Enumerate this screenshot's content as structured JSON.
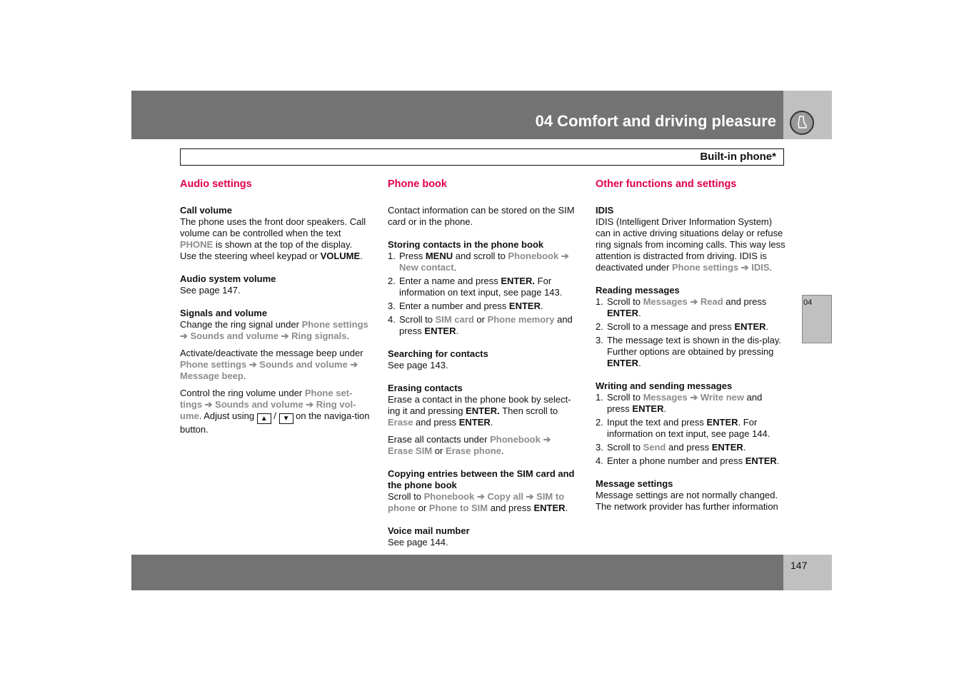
{
  "header": {
    "chapter": "04 Comfort and driving pleasure",
    "section": "Built-in phone*",
    "icon": "seat-icon",
    "tab": "04",
    "page": "147"
  },
  "colors": {
    "accent": "#e0004d",
    "menu": "#8c8c8c",
    "band": "#737373",
    "side": "#c0c0c0"
  },
  "columns": [
    [
      {
        "k": "h2",
        "t": "Audio settings"
      },
      {
        "k": "h3",
        "t": "Call volume"
      },
      {
        "k": "p",
        "s": [
          [
            "The phone uses the front door speakers. Call volume can be controlled when the text "
          ],
          [
            "PHONE",
            "m"
          ],
          [
            " is shown at the top of the display. Use the steering wheel keypad or "
          ],
          [
            "VOLUME",
            "b"
          ],
          [
            "."
          ]
        ]
      },
      {
        "k": "h3",
        "t": "Audio system volume"
      },
      {
        "k": "p",
        "s": [
          [
            "See page 147."
          ]
        ]
      },
      {
        "k": "h3",
        "t": "Signals and volume"
      },
      {
        "k": "p",
        "c": "tight",
        "s": [
          [
            "Change the ring signal under "
          ],
          [
            "Phone settings ➔ Sounds and volume ➔ Ring signals",
            "m"
          ],
          [
            "."
          ]
        ]
      },
      {
        "k": "p",
        "c": "tight",
        "s": [
          [
            "Activate/deactivate the message beep under "
          ],
          [
            "Phone settings ➔ Sounds and volume ➔ Message beep",
            "m"
          ],
          [
            "."
          ]
        ]
      },
      {
        "k": "p",
        "s": [
          [
            "Control the ring volume under "
          ],
          [
            "Phone set-tings ➔ Sounds and volume ➔ Ring vol-ume",
            "m"
          ],
          [
            ". Adjust using "
          ],
          [
            "▲",
            "key"
          ],
          [
            " / "
          ],
          [
            "▼",
            "key"
          ],
          [
            " on the naviga-tion button."
          ]
        ]
      }
    ],
    [
      {
        "k": "h2",
        "t": "Phone book"
      },
      {
        "k": "p",
        "s": [
          [
            "Contact information can be stored on the SIM card or in the phone."
          ]
        ]
      },
      {
        "k": "h3",
        "t": "Storing contacts in the phone book"
      },
      {
        "k": "ol",
        "items": [
          [
            [
              "Press "
            ],
            [
              "MENU",
              "b"
            ],
            [
              " and scroll to "
            ],
            [
              "Phonebook ➔ New contact",
              "m"
            ],
            [
              "."
            ]
          ],
          [
            [
              "Enter a name and press "
            ],
            [
              "ENTER.",
              "b"
            ],
            [
              " For information on text input, see page 143."
            ]
          ],
          [
            [
              "Enter a number and press "
            ],
            [
              "ENTER",
              "b"
            ],
            [
              "."
            ]
          ],
          [
            [
              "Scroll to "
            ],
            [
              "SIM card",
              "m"
            ],
            [
              " or "
            ],
            [
              "Phone memory",
              "m"
            ],
            [
              " and press "
            ],
            [
              "ENTER",
              "b"
            ],
            [
              "."
            ]
          ]
        ]
      },
      {
        "k": "h3",
        "t": "Searching for contacts"
      },
      {
        "k": "p",
        "s": [
          [
            "See page 143."
          ]
        ]
      },
      {
        "k": "h3",
        "t": "Erasing contacts"
      },
      {
        "k": "p",
        "c": "tight",
        "s": [
          [
            "Erase a contact in the phone book by select-ing it and pressing "
          ],
          [
            "ENTER.",
            "b"
          ],
          [
            " Then scroll to "
          ],
          [
            "Erase",
            "m"
          ],
          [
            " and press "
          ],
          [
            "ENTER",
            "b"
          ],
          [
            "."
          ]
        ]
      },
      {
        "k": "p",
        "s": [
          [
            "Erase all contacts under "
          ],
          [
            "Phonebook ➔ Erase SIM",
            "m"
          ],
          [
            " or "
          ],
          [
            "Erase phone",
            "m"
          ],
          [
            "."
          ]
        ]
      },
      {
        "k": "h3",
        "t": "Copying entries between the SIM card and the phone book"
      },
      {
        "k": "p",
        "s": [
          [
            "Scroll to "
          ],
          [
            "Phonebook ➔ Copy all ➔ SIM to phone",
            "m"
          ],
          [
            " or "
          ],
          [
            "Phone to SIM",
            "m"
          ],
          [
            " and press "
          ],
          [
            "ENTER",
            "b"
          ],
          [
            "."
          ]
        ]
      },
      {
        "k": "h3",
        "t": "Voice mail number"
      },
      {
        "k": "p",
        "s": [
          [
            "See page 144."
          ]
        ]
      }
    ],
    [
      {
        "k": "h2",
        "t": "Other functions and settings"
      },
      {
        "k": "h3",
        "t": "IDIS"
      },
      {
        "k": "p",
        "s": [
          [
            "IDIS (Intelligent Driver Information System) can in active driving situations delay or refuse ring signals from incoming calls. This way less attention is distracted from driving. IDIS is deactivated under "
          ],
          [
            "Phone settings ➔ IDIS",
            "m"
          ],
          [
            "."
          ]
        ]
      },
      {
        "k": "h3",
        "t": "Reading messages"
      },
      {
        "k": "ol",
        "items": [
          [
            [
              "Scroll to "
            ],
            [
              "Messages ➔ Read",
              "m"
            ],
            [
              " and press "
            ],
            [
              "ENTER",
              "b"
            ],
            [
              "."
            ]
          ],
          [
            [
              "Scroll to a message and press "
            ],
            [
              "ENTER",
              "b"
            ],
            [
              "."
            ]
          ],
          [
            [
              "The message text is shown in the dis-play. Further options are obtained by pressing "
            ],
            [
              "ENTER",
              "b"
            ],
            [
              "."
            ]
          ]
        ]
      },
      {
        "k": "h3",
        "t": "Writing and sending messages"
      },
      {
        "k": "ol",
        "items": [
          [
            [
              "Scroll to "
            ],
            [
              "Messages ➔ Write new",
              "m"
            ],
            [
              " and press "
            ],
            [
              "ENTER",
              "b"
            ],
            [
              "."
            ]
          ],
          [
            [
              "Input the text and press "
            ],
            [
              "ENTER",
              "b"
            ],
            [
              ". For information on text input, see page 144."
            ]
          ],
          [
            [
              "Scroll to "
            ],
            [
              "Send",
              "m"
            ],
            [
              " and press "
            ],
            [
              "ENTER",
              "b"
            ],
            [
              "."
            ]
          ],
          [
            [
              "Enter a phone number and press "
            ],
            [
              "ENTER",
              "b"
            ],
            [
              "."
            ]
          ]
        ]
      },
      {
        "k": "h3",
        "t": "Message settings"
      },
      {
        "k": "p",
        "s": [
          [
            "Message settings are not normally changed. The network provider has further information"
          ]
        ]
      }
    ]
  ]
}
